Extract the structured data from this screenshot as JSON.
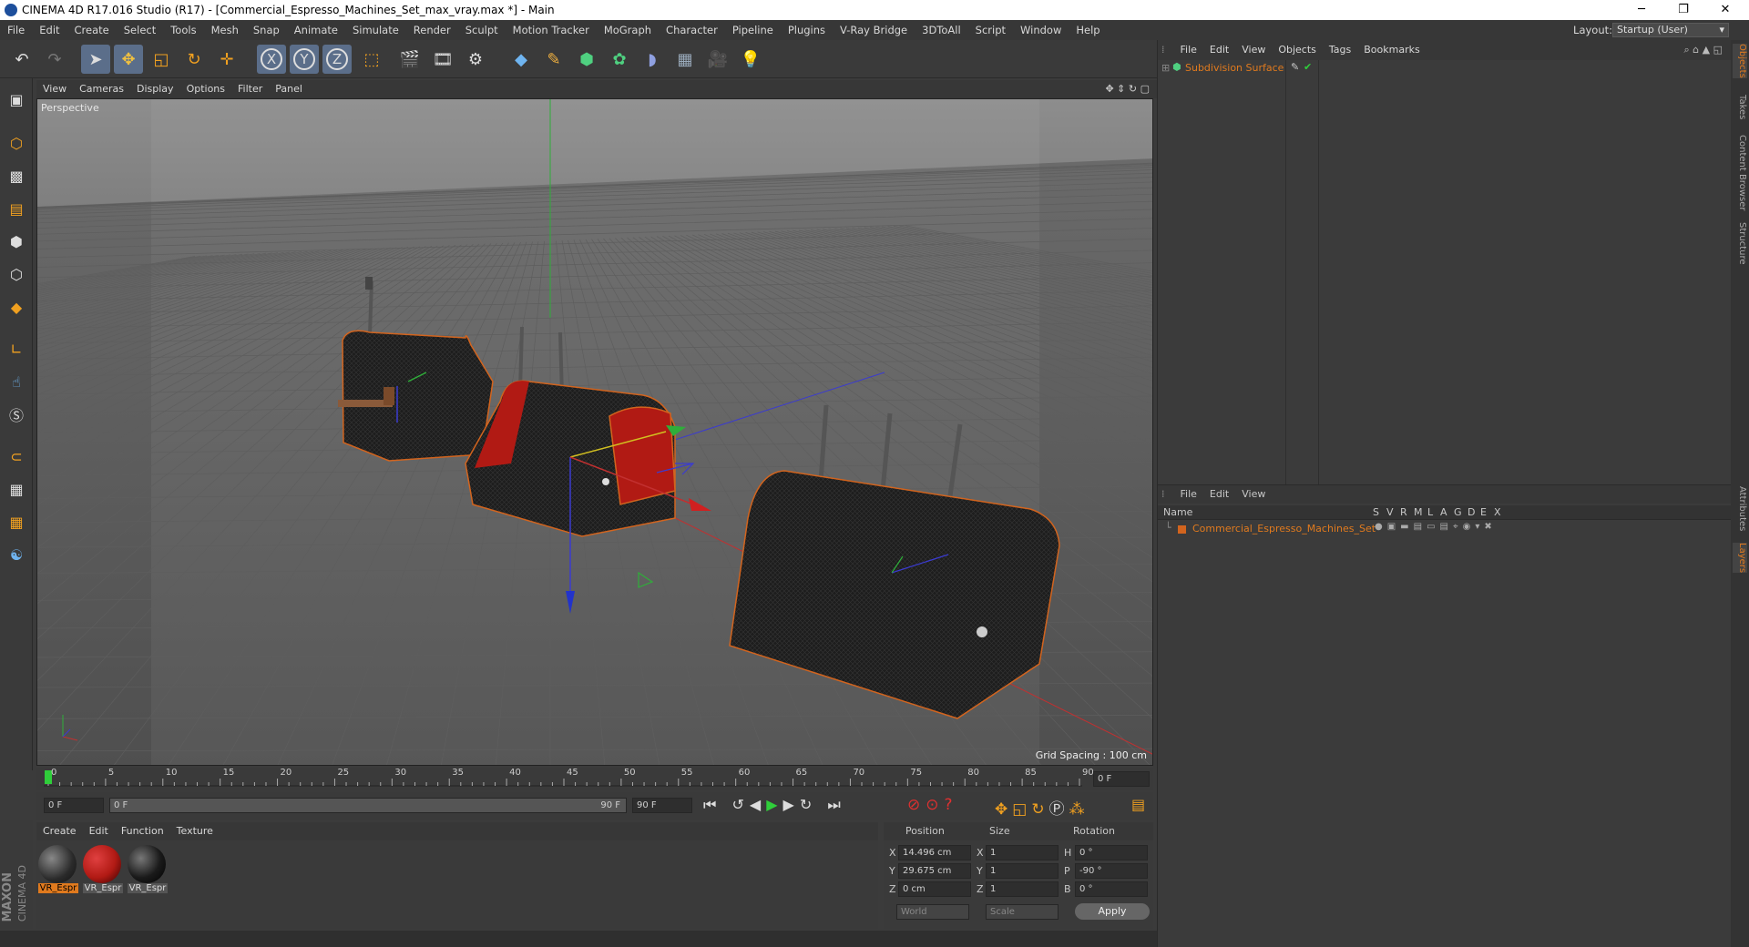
{
  "window": {
    "title": "CINEMA 4D R17.016 Studio (R17) - [Commercial_Espresso_Machines_Set_max_vray.max *] - Main",
    "minimize": "─",
    "restore": "❐",
    "close": "✕"
  },
  "menu": [
    "File",
    "Edit",
    "Create",
    "Select",
    "Tools",
    "Mesh",
    "Snap",
    "Animate",
    "Simulate",
    "Render",
    "Sculpt",
    "Motion Tracker",
    "MoGraph",
    "Character",
    "Pipeline",
    "Plugins",
    "V-Ray Bridge",
    "3DToAll",
    "Script",
    "Window",
    "Help"
  ],
  "layout": {
    "label": "Layout:",
    "value": "Startup (User)"
  },
  "toolbar": {
    "axis_x": "X",
    "axis_y": "Y",
    "axis_z": "Z"
  },
  "viewport": {
    "menu": [
      "View",
      "Cameras",
      "Display",
      "Options",
      "Filter",
      "Panel"
    ],
    "label": "Perspective",
    "grid_spacing": "Grid Spacing : 100 cm"
  },
  "timeline": {
    "ticks": [
      "0",
      "5",
      "10",
      "15",
      "20",
      "25",
      "30",
      "35",
      "40",
      "45",
      "50",
      "55",
      "60",
      "65",
      "70",
      "75",
      "80",
      "85",
      "90"
    ],
    "end_field": "0 F",
    "start_field": "0 F",
    "range_start": "0 F",
    "range_end": "90 F",
    "end_frame": "90 F"
  },
  "materials": {
    "menu": [
      "Create",
      "Edit",
      "Function",
      "Texture"
    ],
    "items": [
      {
        "label": "VR_Espr",
        "color": "#2a2a2a"
      },
      {
        "label": "VR_Espr",
        "color": "#b11a14"
      },
      {
        "label": "VR_Espr",
        "color": "#1a1a1a"
      }
    ]
  },
  "coords": {
    "headers": {
      "position": "Position",
      "size": "Size",
      "rotation": "Rotation"
    },
    "rows": [
      {
        "axis": "X",
        "pos": "14.496 cm",
        "size_axis": "X",
        "size": "1",
        "rot_axis": "H",
        "rot": "0 °"
      },
      {
        "axis": "Y",
        "pos": "29.675 cm",
        "size_axis": "Y",
        "size": "1",
        "rot_axis": "P",
        "rot": "-90 °"
      },
      {
        "axis": "Z",
        "pos": "0 cm",
        "size_axis": "Z",
        "size": "1",
        "rot_axis": "B",
        "rot": "0 °"
      }
    ],
    "world": "World",
    "scale": "Scale",
    "apply": "Apply"
  },
  "object_manager": {
    "menu": [
      "File",
      "Edit",
      "View",
      "Objects",
      "Tags",
      "Bookmarks"
    ],
    "objects": [
      {
        "name": "Subdivision Surface"
      }
    ]
  },
  "layer_manager": {
    "menu": [
      "File",
      "Edit",
      "View"
    ],
    "columns": [
      "Name",
      "S",
      "V",
      "R",
      "M",
      "L",
      "A",
      "G",
      "D",
      "E",
      "X"
    ],
    "layers": [
      {
        "name": "Commercial_Espresso_Machines_Set",
        "color": "#d2641e"
      }
    ]
  },
  "side_tabs": [
    "Objects",
    "Takes",
    "Content Browser",
    "Structure",
    "Attributes",
    "Layers"
  ],
  "branding": {
    "maxon": "MAXON",
    "product": "CINEMA 4D"
  },
  "colors": {
    "accent": "#e07a1e",
    "selection": "#5b6e8a"
  }
}
